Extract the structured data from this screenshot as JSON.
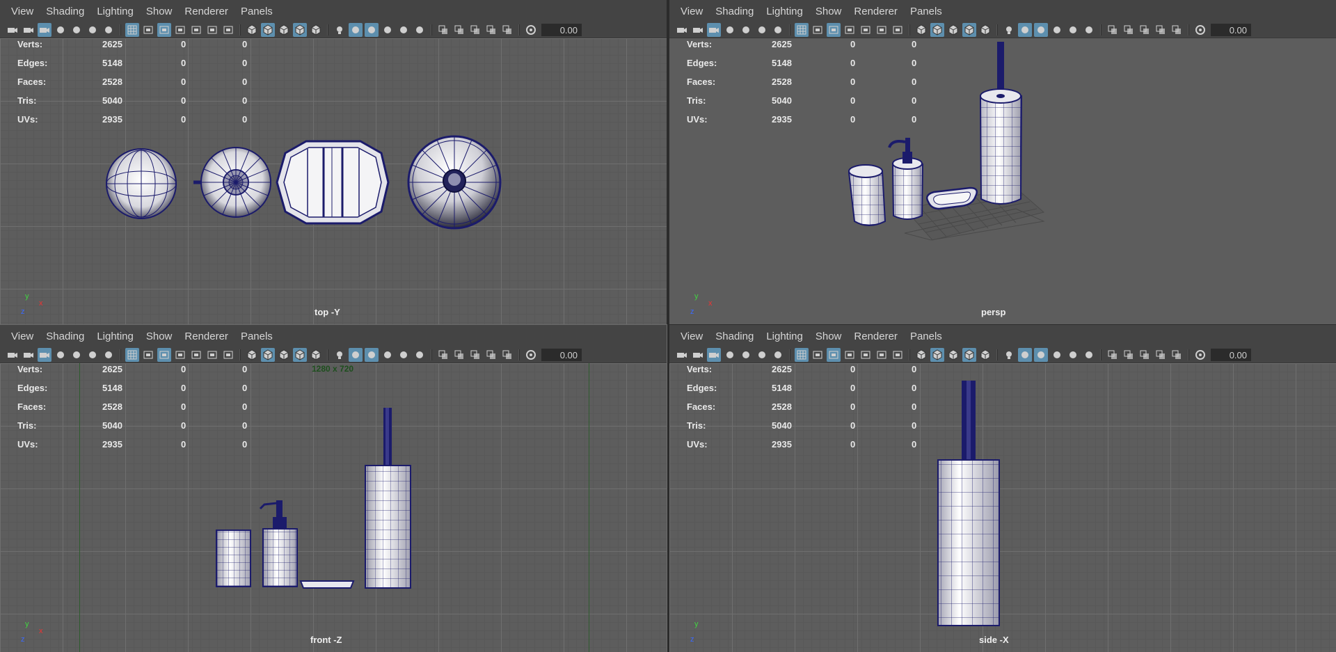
{
  "menu": [
    "View",
    "Shading",
    "Lighting",
    "Show",
    "Renderer",
    "Panels"
  ],
  "toolbar": {
    "icons": [
      "camera-icon",
      "lock-camera-icon",
      "camera-attributes-icon",
      "bookmark-icon",
      "image-plane-icon",
      "grease-pencil-icon",
      "2d-pan-zoom-icon",
      "grid-icon",
      "film-gate-icon",
      "resolution-gate-icon",
      "gate-mask-icon",
      "field-chart-icon",
      "safe-action-icon",
      "safe-title-icon",
      "wireframe-icon",
      "smooth-shade-icon",
      "default-material-icon",
      "wireframe-on-shaded-icon",
      "textured-icon",
      "use-all-lights-icon",
      "shadows-icon",
      "ambient-occlusion-icon",
      "motion-blur-icon",
      "anti-alias-icon",
      "depth-of-field-icon",
      "isolate-select-icon",
      "xray-icon",
      "xray-joints-icon",
      "xray-components-icon",
      "backface-culling-icon",
      "exposure-icon"
    ],
    "exposure_value": "0.00"
  },
  "hud": {
    "rows": [
      {
        "label": "Verts:",
        "v1": "2625",
        "v2": "0",
        "v3": "0"
      },
      {
        "label": "Edges:",
        "v1": "5148",
        "v2": "0",
        "v3": "0"
      },
      {
        "label": "Faces:",
        "v1": "2528",
        "v2": "0",
        "v3": "0"
      },
      {
        "label": "Tris:",
        "v1": "5040",
        "v2": "0",
        "v3": "0"
      },
      {
        "label": "UVs:",
        "v1": "2935",
        "v2": "0",
        "v3": "0"
      }
    ]
  },
  "viewports": [
    {
      "id": "top",
      "camera": "top -Y",
      "axes": {
        "first": "y",
        "second": "x",
        "third": "z"
      }
    },
    {
      "id": "persp",
      "camera": "persp",
      "axes": {
        "first": "y",
        "second": "x",
        "third": "z"
      }
    },
    {
      "id": "front",
      "camera": "front -Z",
      "resolution": "1280 x 720",
      "axes": {
        "first": "y",
        "second": "x",
        "third": "z"
      }
    },
    {
      "id": "side",
      "camera": "side -X",
      "axes": {
        "first": "y",
        "second": "z",
        "third": ""
      }
    }
  ],
  "colors": {
    "viewport_bg": "#5d5d5d",
    "panel_bg": "#444444",
    "toggle_on": "#5d8fae",
    "mesh_wire": "#1b1b6b",
    "mesh_fill": "#e8e8ee"
  }
}
